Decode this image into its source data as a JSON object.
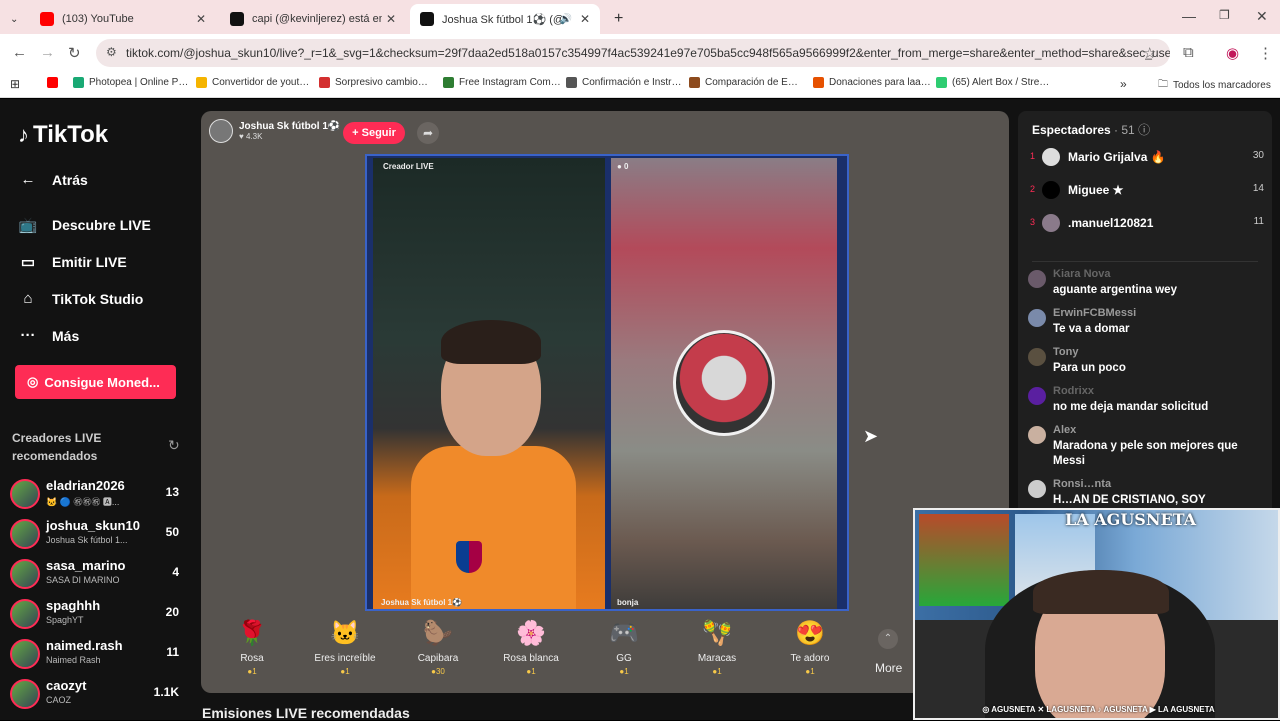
{
  "browser": {
    "tabs": [
      {
        "title": "(103) YouTube",
        "favicon_color": "#ff0000"
      },
      {
        "title": "capi (@kevinljerez) está emitie…",
        "favicon_color": "#111111"
      },
      {
        "title": "Joshua Sk fútbol 1⚽ (@jos…",
        "favicon_color": "#111111"
      }
    ],
    "new_tab": "+",
    "window_controls": {
      "minimize": "—",
      "restore": "❐",
      "close": "✕"
    },
    "url": "tiktok.com/@joshua_skun10/live?_r=1&_svg=1&checksum=29f7daa2ed518a0157c354997f4ac539241e97e705ba5cc948f565a9566999f2&enter_from_merge=share&enter_method=share&sec_user_id=M…",
    "bookmarks": [
      {
        "label": "",
        "color": "#ff0000"
      },
      {
        "label": "Photopea | Online P…",
        "color": "#19a974"
      },
      {
        "label": "Convertidor de yout…",
        "color": "#f5b400"
      },
      {
        "label": "Sorpresivo cambio…",
        "color": "#d32f2f"
      },
      {
        "label": "Free Instagram Com…",
        "color": "#2e7d32"
      },
      {
        "label": "Confirmación e Instr…",
        "color": "#555555"
      },
      {
        "label": "Comparación de E…",
        "color": "#8d4b1e"
      },
      {
        "label": "Donaciones para laa…",
        "color": "#e65100"
      },
      {
        "label": "(65) Alert Box / Stre…",
        "color": "#2ecc71"
      }
    ],
    "bookmarks_more": "»",
    "all_bookmarks": "Todos los marcadores"
  },
  "sidebar": {
    "logo": "TikTok",
    "back": "Atrás",
    "nav": [
      {
        "label": "Descubre LIVE",
        "icon": "tv-icon"
      },
      {
        "label": "Emitir LIVE",
        "icon": "camera-icon"
      },
      {
        "label": "TikTok Studio",
        "icon": "house-icon"
      },
      {
        "label": "Más",
        "icon": "more-icon"
      }
    ],
    "coins_button": "Consigue Moned...",
    "recommended_title": "Creadores LIVE recomendados",
    "creators": [
      {
        "name": "eladrian2026",
        "sub": "🐱 🔵 ㊗㊗㊗ 🅰...",
        "count": "13"
      },
      {
        "name": "joshua_skun10",
        "sub": "Joshua Sk fútbol 1...",
        "count": "50"
      },
      {
        "name": "sasa_marino",
        "sub": "SASA DI MARINO",
        "count": "4"
      },
      {
        "name": "spaghhh",
        "sub": "SpaghYT",
        "count": "20"
      },
      {
        "name": "naimed.rash",
        "sub": "Naimed Rash",
        "count": "11"
      },
      {
        "name": "caozyt",
        "sub": "CAOZ",
        "count": "1.1K"
      }
    ]
  },
  "stream": {
    "host_name": "Joshua Sk fútbol 1⚽",
    "host_likes": "♥ 4.3K",
    "follow_label": "+ Seguir",
    "left_tag": "Creador LIVE",
    "right_tag": "● 0",
    "left_caption": "Joshua Sk fútbol 1⚽",
    "right_caption": "bonja",
    "gifts": [
      {
        "name": "Rosa",
        "price": "●1",
        "icon": "🌹"
      },
      {
        "name": "Eres increíble",
        "price": "●1",
        "icon": "🐱"
      },
      {
        "name": "Capibara",
        "price": "●30",
        "icon": "🦫"
      },
      {
        "name": "Rosa blanca",
        "price": "●1",
        "icon": "🌸"
      },
      {
        "name": "GG",
        "price": "●1",
        "icon": "🎮"
      },
      {
        "name": "Maracas",
        "price": "●1",
        "icon": "🪇"
      },
      {
        "name": "Te adoro",
        "price": "●1",
        "icon": "😍"
      }
    ],
    "more_label": "More",
    "section_heading": "Emisiones LIVE recomendadas"
  },
  "panel": {
    "spectators_label": "Espectadores",
    "spectators_count": "· 51",
    "ranking": [
      {
        "pos": "1",
        "name": "Mario Grijalva 🔥",
        "count": "30"
      },
      {
        "pos": "2",
        "name": "Miguee ★",
        "count": "14"
      },
      {
        "pos": "3",
        "name": ".manuel120821",
        "count": "11"
      }
    ],
    "messages": [
      {
        "user": "Kiara Nova",
        "text": "aguante argentina wey"
      },
      {
        "user": "ErwinFCBMessi",
        "text": "Te va a domar"
      },
      {
        "user": "Tony",
        "text": "Para un poco"
      },
      {
        "user": "Rodrixx",
        "text": "no me deja mandar solicitud"
      },
      {
        "user": "Alex",
        "text": "Maradona y pele son mejores que Messi"
      },
      {
        "user": "Ronsi…nta",
        "text": "H…AN DE CRISTIANO, SOY"
      }
    ]
  },
  "webcam": {
    "brand": "LA AGUSNETA",
    "socials": "◎ AGUSNETA ✕ LAGUSNETA ♪ AGUSNETA ▶ LA AGUSNETA"
  }
}
